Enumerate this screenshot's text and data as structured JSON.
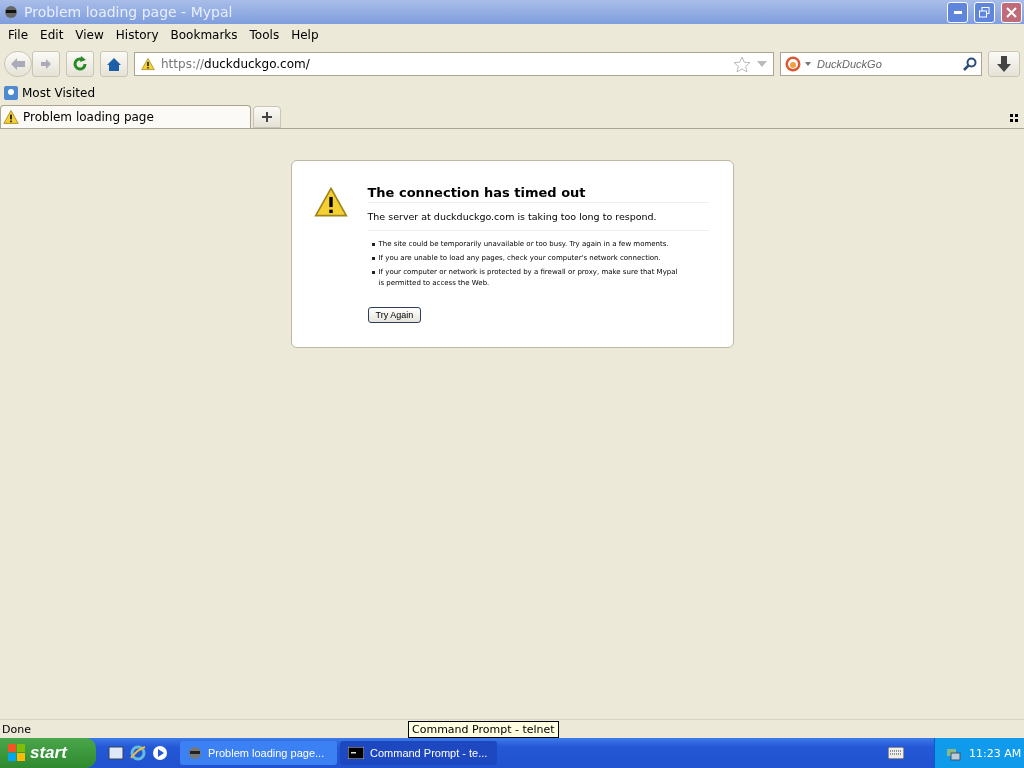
{
  "window": {
    "title": "Problem loading page - Mypal"
  },
  "menu": [
    "File",
    "Edit",
    "View",
    "History",
    "Bookmarks",
    "Tools",
    "Help"
  ],
  "navigation": {
    "url_scheme": "https://",
    "url_host": "duckduckgo.com/",
    "search_placeholder": "DuckDuckGo"
  },
  "bookmarks": [
    {
      "label": "Most Visited"
    }
  ],
  "tabs": [
    {
      "label": "Problem loading page",
      "selected": true
    }
  ],
  "error": {
    "title": "The connection has timed out",
    "message": "The server at duckduckgo.com is taking too long to respond.",
    "tips": [
      "The site could be temporarily unavailable or too busy. Try again in a few moments.",
      "If you are unable to load any pages, check your computer's network connection.",
      "If your computer or network is protected by a firewall or proxy, make sure that Mypal is permitted to access the Web."
    ],
    "button": "Try Again"
  },
  "status_bar": {
    "text": "Done"
  },
  "tooltip": "Command Prompt - telnet",
  "taskbar": {
    "start": "start",
    "tasks": [
      {
        "label": "Problem loading page...",
        "kind": "browser",
        "selected": true
      },
      {
        "label": "Command Prompt - te...",
        "kind": "console",
        "selected": false
      }
    ],
    "clock": "11:23 AM"
  }
}
